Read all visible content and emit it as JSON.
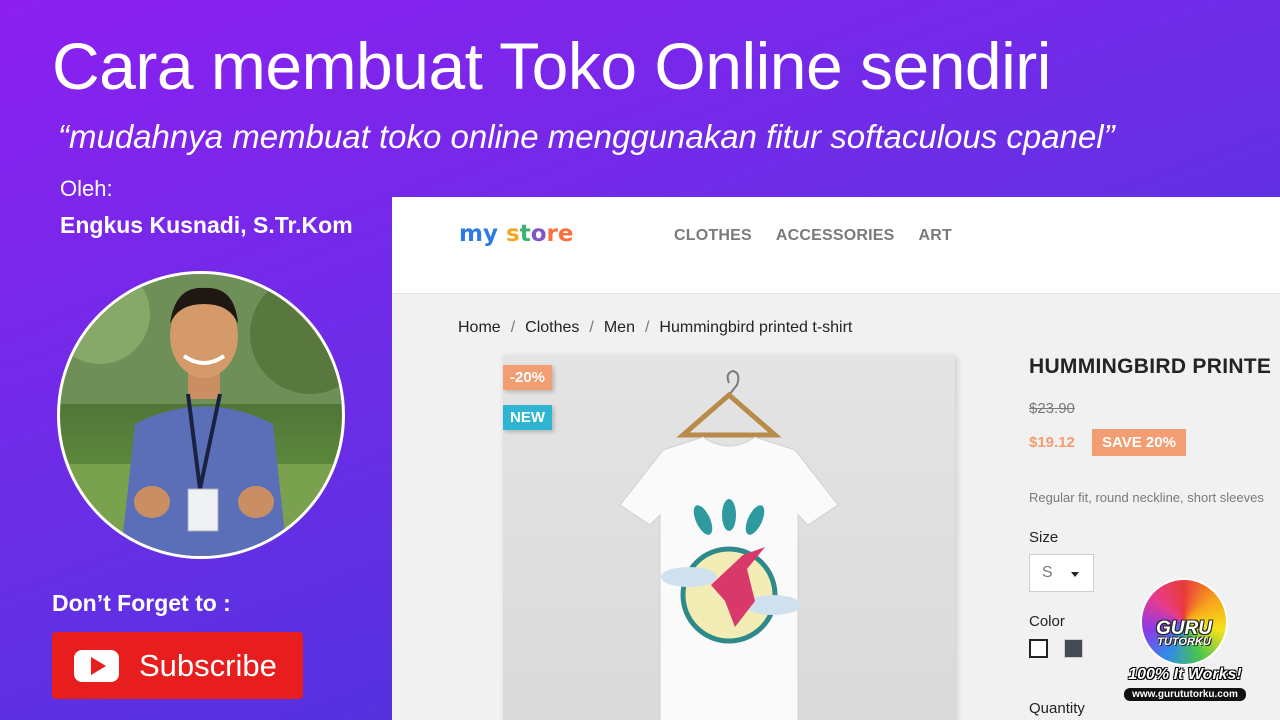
{
  "slide": {
    "title": "Cara membuat Toko Online sendiri",
    "subtitle": "“mudahnya membuat toko online menggunakan fitur softaculous cpanel”",
    "by_label": "Oleh:",
    "author": "Engkus Kusnadi, S.Tr.Kom",
    "reminder": "Don’t Forget to :",
    "subscribe_label": "Subscribe"
  },
  "store": {
    "logo": [
      "my",
      " ",
      "s",
      "t",
      "o",
      "re"
    ],
    "nav": [
      "CLOTHES",
      "ACCESSORIES",
      "ART"
    ],
    "breadcrumb": [
      "Home",
      "Clothes",
      "Men",
      "Hummingbird printed t-shirt"
    ],
    "product": {
      "discount_flag": "-20%",
      "new_flag": "NEW",
      "title": "HUMMINGBIRD PRINTE",
      "old_price": "$23.90",
      "price": "$19.12",
      "save_badge": "SAVE 20%",
      "description": "Regular fit, round neckline, short sleeves",
      "size_label": "Size",
      "size_value": "S",
      "color_label": "Color",
      "colors": [
        "#ffffff",
        "#434a54"
      ],
      "quantity_label": "Quantity"
    }
  },
  "watermark": {
    "brand_line1": "GURU",
    "brand_line2": "TUTORKU",
    "tagline": "100% It Works!",
    "url": "www.gurututorku.com"
  },
  "colors": {
    "accent_purple": "#8c1ff0",
    "subscribe_red": "#e81d1d",
    "price_orange": "#f39d72",
    "new_blue": "#2fb5d2"
  }
}
